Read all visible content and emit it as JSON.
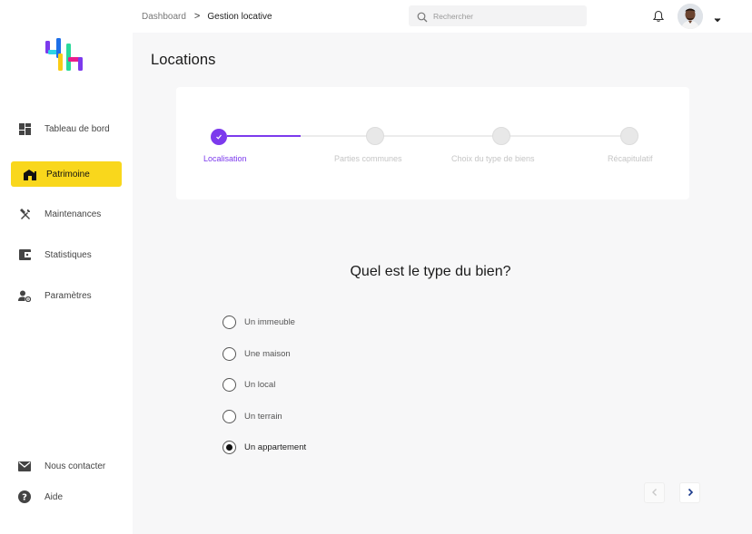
{
  "sidebar": {
    "items": [
      {
        "label": "Tableau de bord",
        "icon": "dashboard-icon"
      },
      {
        "label": "Patrimoine",
        "icon": "building-icon"
      },
      {
        "label": "Maintenances",
        "icon": "tools-icon"
      },
      {
        "label": "Statistiques",
        "icon": "wallet-icon"
      },
      {
        "label": "Paramètres",
        "icon": "user-settings-icon"
      }
    ],
    "bottom": [
      {
        "label": "Nous contacter",
        "icon": "mail-icon"
      },
      {
        "label": "Aide",
        "icon": "help-icon"
      }
    ],
    "active_index": 1
  },
  "topbar": {
    "breadcrumb": [
      "Dashboard",
      "Gestion locative"
    ],
    "breadcrumb_sep": ">",
    "search_placeholder": "Rechercher"
  },
  "main": {
    "title": "Locations",
    "stepper": {
      "steps": [
        "Localisation",
        "Parties communes",
        "Choix du type de biens",
        "Récapitulatif"
      ],
      "current": 0
    },
    "question": "Quel est le type du bien?",
    "options": [
      "Un immeuble",
      "Une maison",
      "Un local",
      "Un terrain",
      "Un appartement"
    ],
    "selected_option": 4,
    "pager": {
      "prev": "‹",
      "next": "›"
    }
  },
  "colors": {
    "accent": "#7c3aed",
    "active_nav": "#f9d71c",
    "pager_next": "#1a3a8c"
  }
}
